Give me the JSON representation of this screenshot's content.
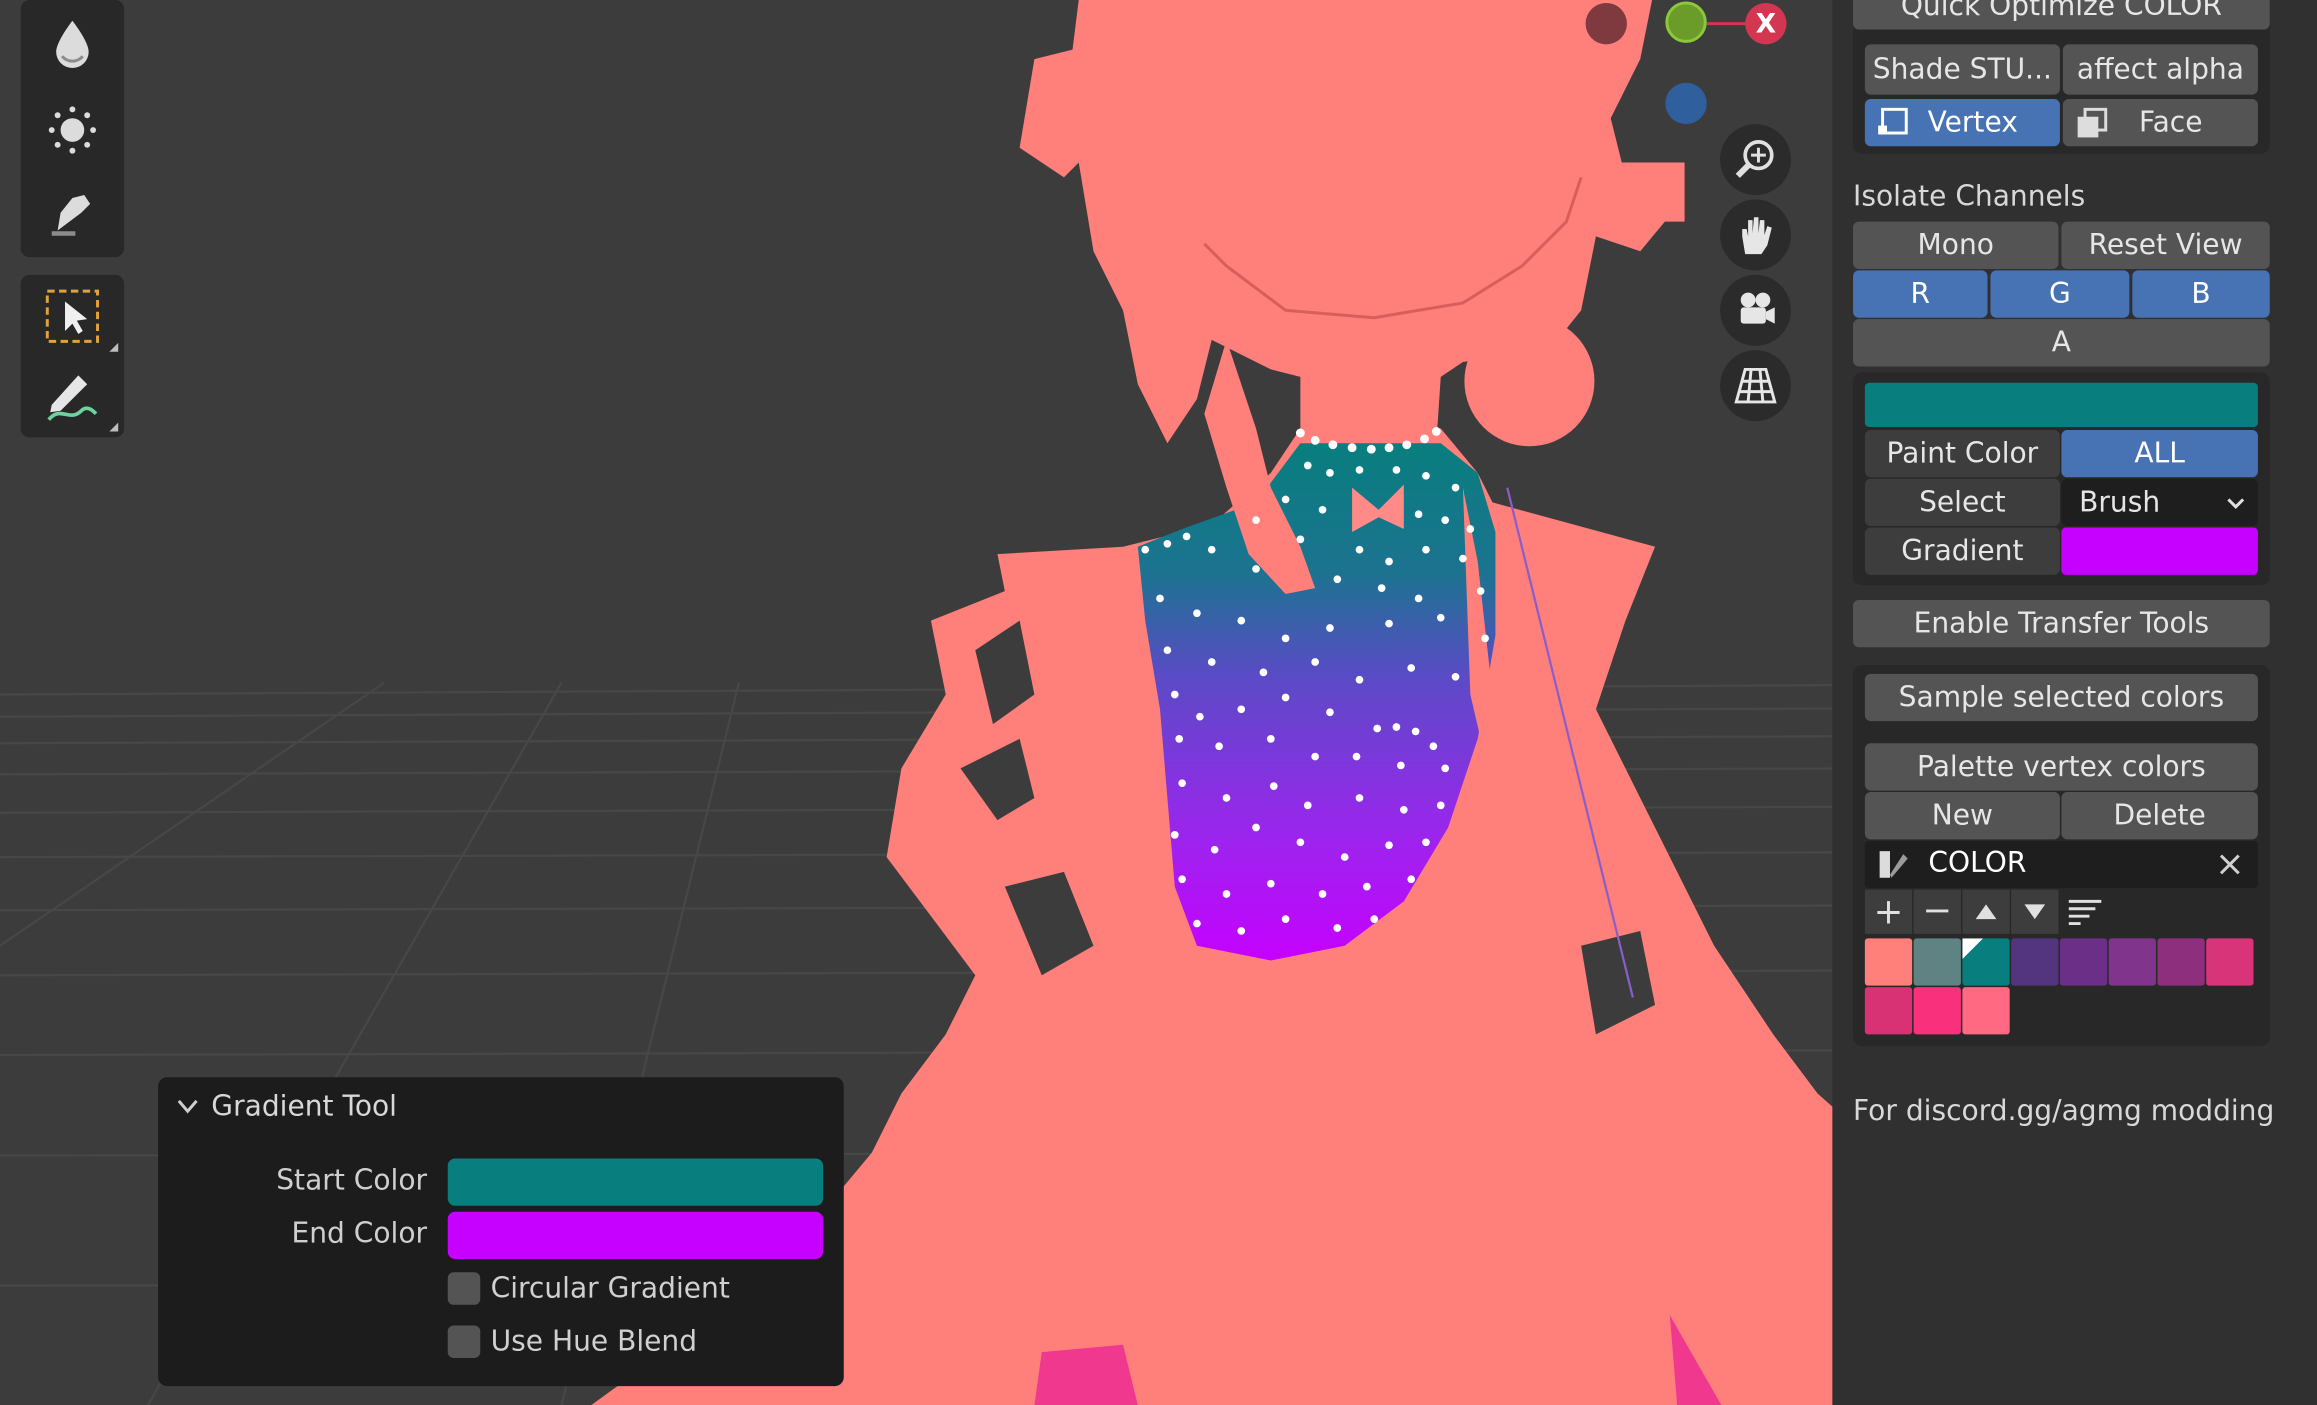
{
  "npanel": {
    "quick_optimize": "Quick Optimize COLOR",
    "shade_stu": "Shade STU...",
    "affect_alpha": "affect alpha",
    "vertex": "Vertex",
    "face": "Face",
    "isolate_channels": "Isolate Channels",
    "mono": "Mono",
    "reset_view": "Reset View",
    "r": "R",
    "g": "G",
    "b": "B",
    "a": "A",
    "paint_color": "Paint Color",
    "all": "ALL",
    "select": "Select",
    "brush": "Brush",
    "gradient": "Gradient",
    "enable_transfer": "Enable Transfer Tools",
    "sample_selected": "Sample selected colors",
    "palette_vertex": "Palette vertex colors",
    "new": "New",
    "delete": "Delete",
    "palette_name": "COLOR",
    "footer": "For discord.gg/agmg modding"
  },
  "gizmo": {
    "x_label": "X"
  },
  "palette_swatches": [
    "#ff7f7b",
    "#5f8282",
    "#087e7e",
    "#53357f",
    "#6b2f87",
    "#80348b",
    "#8e2f7e",
    "#d7347a",
    "#d83274",
    "#f9307c",
    "#ff6a82"
  ],
  "colors": {
    "accent_blue": "#4772b3",
    "start_color": "#087e7e",
    "end_color": "#c601ff",
    "character": "#ff7f7b"
  },
  "gradient_tool": {
    "title": "Gradient Tool",
    "start_color_label": "Start Color",
    "end_color_label": "End Color",
    "circular_gradient": "Circular Gradient",
    "use_hue_blend": "Use Hue Blend"
  },
  "icons": [
    "drop-icon",
    "blur-icon",
    "smear-icon",
    "box-select-icon",
    "annotate-icon",
    "zoom-icon",
    "hand-icon",
    "camera-icon",
    "grid-icon",
    "palette-icon",
    "add-icon",
    "remove-icon",
    "move-up-icon",
    "move-down-icon",
    "sort-icon",
    "chevron-down-icon"
  ]
}
